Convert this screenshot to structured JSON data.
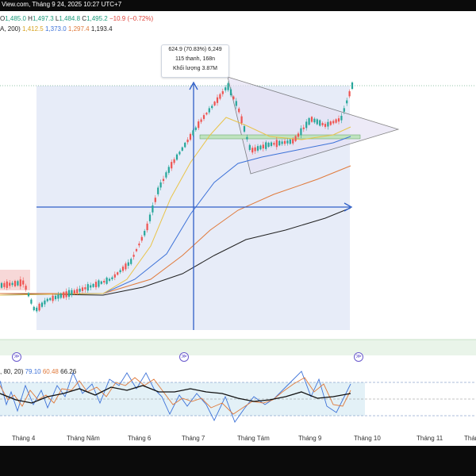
{
  "header": {
    "title_fragment": "View.com, Tháng 9 24, 2025 10:27 UTC+7"
  },
  "ohlc": {
    "open_label": "O",
    "open": "1,485.0",
    "high_label": "H",
    "high": "1,497.3",
    "low_label": "L",
    "low": "1,484.8",
    "close_label": "C",
    "close": "1,495.2",
    "change": "−10.9 (−0.72%)"
  },
  "moving_averages": {
    "label": "A, 200)",
    "values": [
      "1,412.5",
      "1,373.0",
      "1,297.4",
      "1,193.4"
    ],
    "colors": [
      "#d7a322",
      "#3d72d8",
      "#e07a3b",
      "#222222"
    ]
  },
  "measure_tooltip": {
    "line1": "624.9 (70.83%) 6,249",
    "line2": "115 thanh, 168n",
    "line3": "Khối lượng 3.87M"
  },
  "oscillator": {
    "label": ", 80, 20)",
    "values": [
      "79.10",
      "60.48",
      "66.26"
    ],
    "colors": [
      "#3d72d8",
      "#e07a3b",
      "#222222"
    ]
  },
  "xaxis": {
    "labels": [
      "Tháng 4",
      "Tháng Năm",
      "Tháng 6",
      "Tháng 7",
      "Tháng Tám",
      "Tháng 9",
      "Tháng 10",
      "Tháng 11",
      "Tháng"
    ]
  },
  "event_markers": {
    "glyph": "≫"
  },
  "colors": {
    "up_candle": "#26a69a",
    "down_candle": "#ef5350",
    "measure_box": "#dfe6f5",
    "triangle": "#7b6fd0",
    "arrow": "#2f5fc7",
    "grid_dots": "#2e8b57"
  }
}
